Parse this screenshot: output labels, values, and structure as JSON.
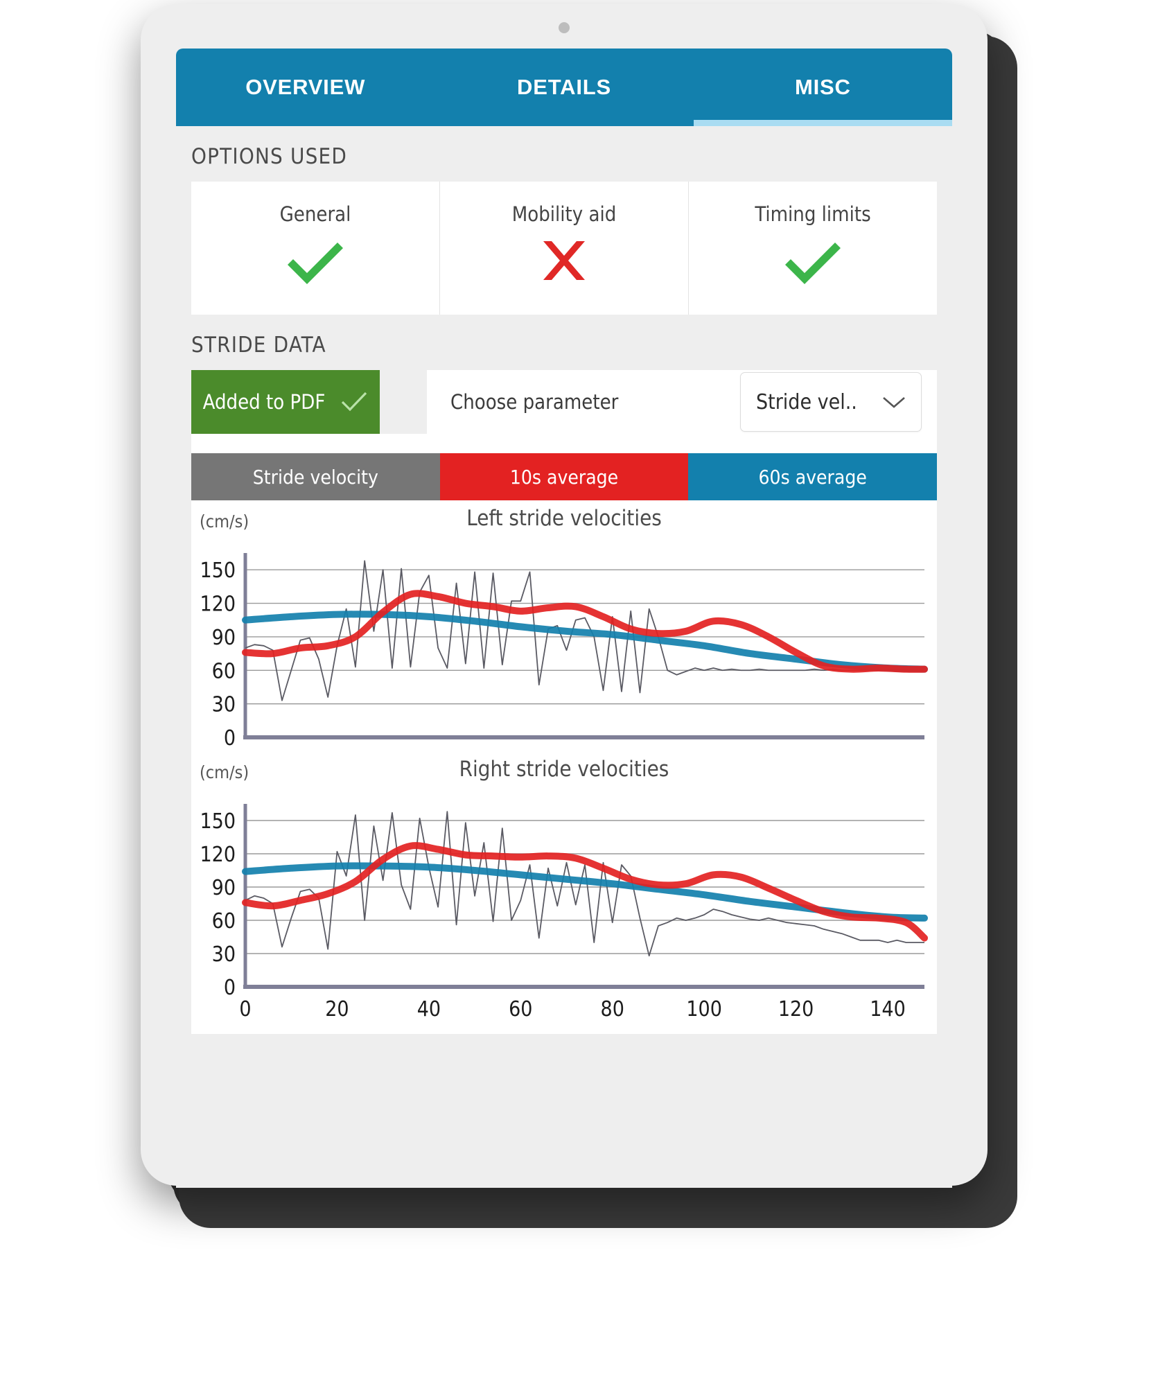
{
  "tabs": [
    {
      "label": "OVERVIEW",
      "active": false
    },
    {
      "label": "DETAILS",
      "active": false
    },
    {
      "label": "MISC",
      "active": true
    }
  ],
  "options_section": {
    "heading": "OPTIONS USED",
    "cards": [
      {
        "label": "General",
        "mark": "check",
        "mark_icon": "green-check-icon"
      },
      {
        "label": "Mobility aid",
        "mark": "cross",
        "mark_icon": "red-cross-icon"
      },
      {
        "label": "Timing limits",
        "mark": "check",
        "mark_icon": "green-check-icon"
      }
    ]
  },
  "stride_section": {
    "heading": "STRIDE DATA",
    "pdf_button": {
      "label": "Added to PDF",
      "icon": "check-icon"
    },
    "choose_parameter_label": "Choose parameter",
    "parameter_select": {
      "value": "Stride vel..",
      "icon": "chevron-down-icon"
    },
    "segments": [
      {
        "label": "Stride velocity",
        "color": "#767676"
      },
      {
        "label": "10s average",
        "color": "#e32222"
      },
      {
        "label": "60s average",
        "color": "#1380ad"
      }
    ]
  },
  "colors": {
    "brand_blue": "#1380ad",
    "tab_underline": "#a9dcf2",
    "green": "#4b8b2b",
    "check_green": "#3cb54a",
    "cross_red": "#e02826",
    "segment_grey": "#767676",
    "segment_red": "#e32222",
    "segment_blue": "#1380ad",
    "raw_line": "#5a5a63",
    "avg10_line": "#e32222",
    "avg60_line": "#1380ad",
    "screen_bg": "#eeeeee",
    "panel_bg": "#ffffff"
  },
  "chart_data": [
    {
      "type": "line",
      "title": "Left stride velocities",
      "ylabel": "(cm/s)",
      "xlabel": "",
      "ylim": [
        0,
        165
      ],
      "xlim": [
        0,
        148
      ],
      "yticks": [
        0,
        30,
        60,
        90,
        120,
        150
      ],
      "xticks": [
        0,
        20,
        40,
        60,
        80,
        100,
        120,
        140
      ],
      "xticks_visible": false,
      "grid": true,
      "legend": [
        "Stride velocity",
        "10s average",
        "60s average"
      ],
      "legend_position": "segmented-control-above",
      "series": [
        {
          "name": "Stride velocity",
          "color": "#5a5a63",
          "x": [
            0,
            2,
            4,
            6,
            8,
            10,
            12,
            14,
            16,
            18,
            20,
            22,
            24,
            26,
            28,
            30,
            32,
            34,
            36,
            38,
            40,
            42,
            44,
            46,
            48,
            50,
            52,
            54,
            56,
            58,
            60,
            62,
            64,
            66,
            68,
            70,
            72,
            74,
            76,
            78,
            80,
            82,
            84,
            86,
            88,
            90,
            92,
            94,
            96,
            98,
            100,
            102,
            104,
            106,
            108,
            110,
            112,
            114,
            116,
            118,
            120,
            122,
            124,
            126,
            128,
            130,
            132,
            134,
            136,
            138,
            140,
            142,
            144,
            146,
            148
          ],
          "values": [
            80,
            83,
            82,
            78,
            33,
            60,
            87,
            89,
            70,
            36,
            82,
            115,
            63,
            158,
            95,
            150,
            62,
            151,
            63,
            130,
            145,
            80,
            62,
            138,
            66,
            148,
            62,
            147,
            65,
            122,
            122,
            148,
            47,
            97,
            100,
            78,
            105,
            107,
            90,
            42,
            108,
            41,
            113,
            40,
            115,
            90,
            60,
            56,
            59,
            62,
            60,
            62,
            60,
            61,
            60,
            60,
            61,
            60,
            60,
            60,
            60,
            60,
            61,
            60,
            61,
            60,
            60,
            60,
            60,
            60,
            60,
            61,
            60,
            60,
            60
          ]
        },
        {
          "name": "10s average",
          "color": "#e32222",
          "x": [
            0,
            6,
            12,
            18,
            24,
            30,
            36,
            42,
            48,
            54,
            60,
            66,
            72,
            78,
            84,
            90,
            96,
            102,
            108,
            114,
            120,
            126,
            132,
            138,
            144,
            148
          ],
          "values": [
            76,
            75,
            80,
            82,
            90,
            112,
            128,
            126,
            120,
            117,
            113,
            116,
            117,
            108,
            97,
            93,
            95,
            104,
            101,
            90,
            76,
            64,
            61,
            62,
            61,
            61
          ]
        },
        {
          "name": "60s average",
          "color": "#1380ad",
          "x": [
            0,
            10,
            20,
            30,
            40,
            50,
            60,
            70,
            80,
            90,
            100,
            110,
            120,
            130,
            140,
            148
          ],
          "values": [
            105,
            108,
            110,
            110,
            108,
            104,
            99,
            95,
            92,
            87,
            82,
            75,
            70,
            65,
            62,
            61
          ]
        }
      ]
    },
    {
      "type": "line",
      "title": "Right stride velocities",
      "ylabel": "(cm/s)",
      "xlabel": "",
      "ylim": [
        0,
        165
      ],
      "xlim": [
        0,
        148
      ],
      "yticks": [
        0,
        30,
        60,
        90,
        120,
        150
      ],
      "xticks": [
        0,
        20,
        40,
        60,
        80,
        100,
        120,
        140
      ],
      "xticks_visible": true,
      "grid": true,
      "legend": [
        "Stride velocity",
        "10s average",
        "60s average"
      ],
      "legend_position": "segmented-control-above",
      "series": [
        {
          "name": "Stride velocity",
          "color": "#5a5a63",
          "x": [
            0,
            2,
            4,
            6,
            8,
            10,
            12,
            14,
            16,
            18,
            20,
            22,
            24,
            26,
            28,
            30,
            32,
            34,
            36,
            38,
            40,
            42,
            44,
            46,
            48,
            50,
            52,
            54,
            56,
            58,
            60,
            62,
            64,
            66,
            68,
            70,
            72,
            74,
            76,
            78,
            80,
            82,
            84,
            86,
            88,
            90,
            92,
            94,
            96,
            98,
            100,
            102,
            104,
            106,
            108,
            110,
            112,
            114,
            116,
            118,
            120,
            122,
            124,
            126,
            128,
            130,
            132,
            134,
            136,
            138,
            140,
            142,
            144,
            146,
            148
          ],
          "values": [
            78,
            82,
            80,
            75,
            36,
            62,
            86,
            88,
            80,
            34,
            122,
            100,
            155,
            60,
            145,
            96,
            157,
            92,
            70,
            152,
            108,
            72,
            158,
            56,
            148,
            82,
            130,
            59,
            143,
            60,
            78,
            110,
            44,
            107,
            73,
            112,
            74,
            110,
            40,
            112,
            58,
            110,
            100,
            62,
            28,
            55,
            58,
            62,
            60,
            62,
            65,
            70,
            68,
            65,
            63,
            61,
            60,
            62,
            60,
            58,
            57,
            56,
            55,
            52,
            50,
            48,
            45,
            42,
            42,
            42,
            40,
            42,
            40,
            40,
            40
          ]
        },
        {
          "name": "10s average",
          "color": "#e32222",
          "x": [
            0,
            6,
            12,
            18,
            24,
            30,
            36,
            42,
            48,
            54,
            60,
            66,
            72,
            78,
            84,
            90,
            96,
            102,
            108,
            114,
            120,
            126,
            132,
            138,
            144,
            148
          ],
          "values": [
            76,
            73,
            78,
            84,
            95,
            115,
            127,
            124,
            119,
            118,
            117,
            118,
            116,
            107,
            97,
            92,
            93,
            101,
            99,
            89,
            78,
            68,
            63,
            62,
            58,
            44
          ]
        },
        {
          "name": "60s average",
          "color": "#1380ad",
          "x": [
            0,
            10,
            20,
            30,
            40,
            50,
            60,
            70,
            80,
            90,
            100,
            110,
            120,
            130,
            140,
            148
          ],
          "values": [
            104,
            107,
            109,
            109,
            108,
            105,
            101,
            97,
            93,
            88,
            83,
            77,
            72,
            67,
            63,
            62
          ]
        }
      ]
    }
  ]
}
